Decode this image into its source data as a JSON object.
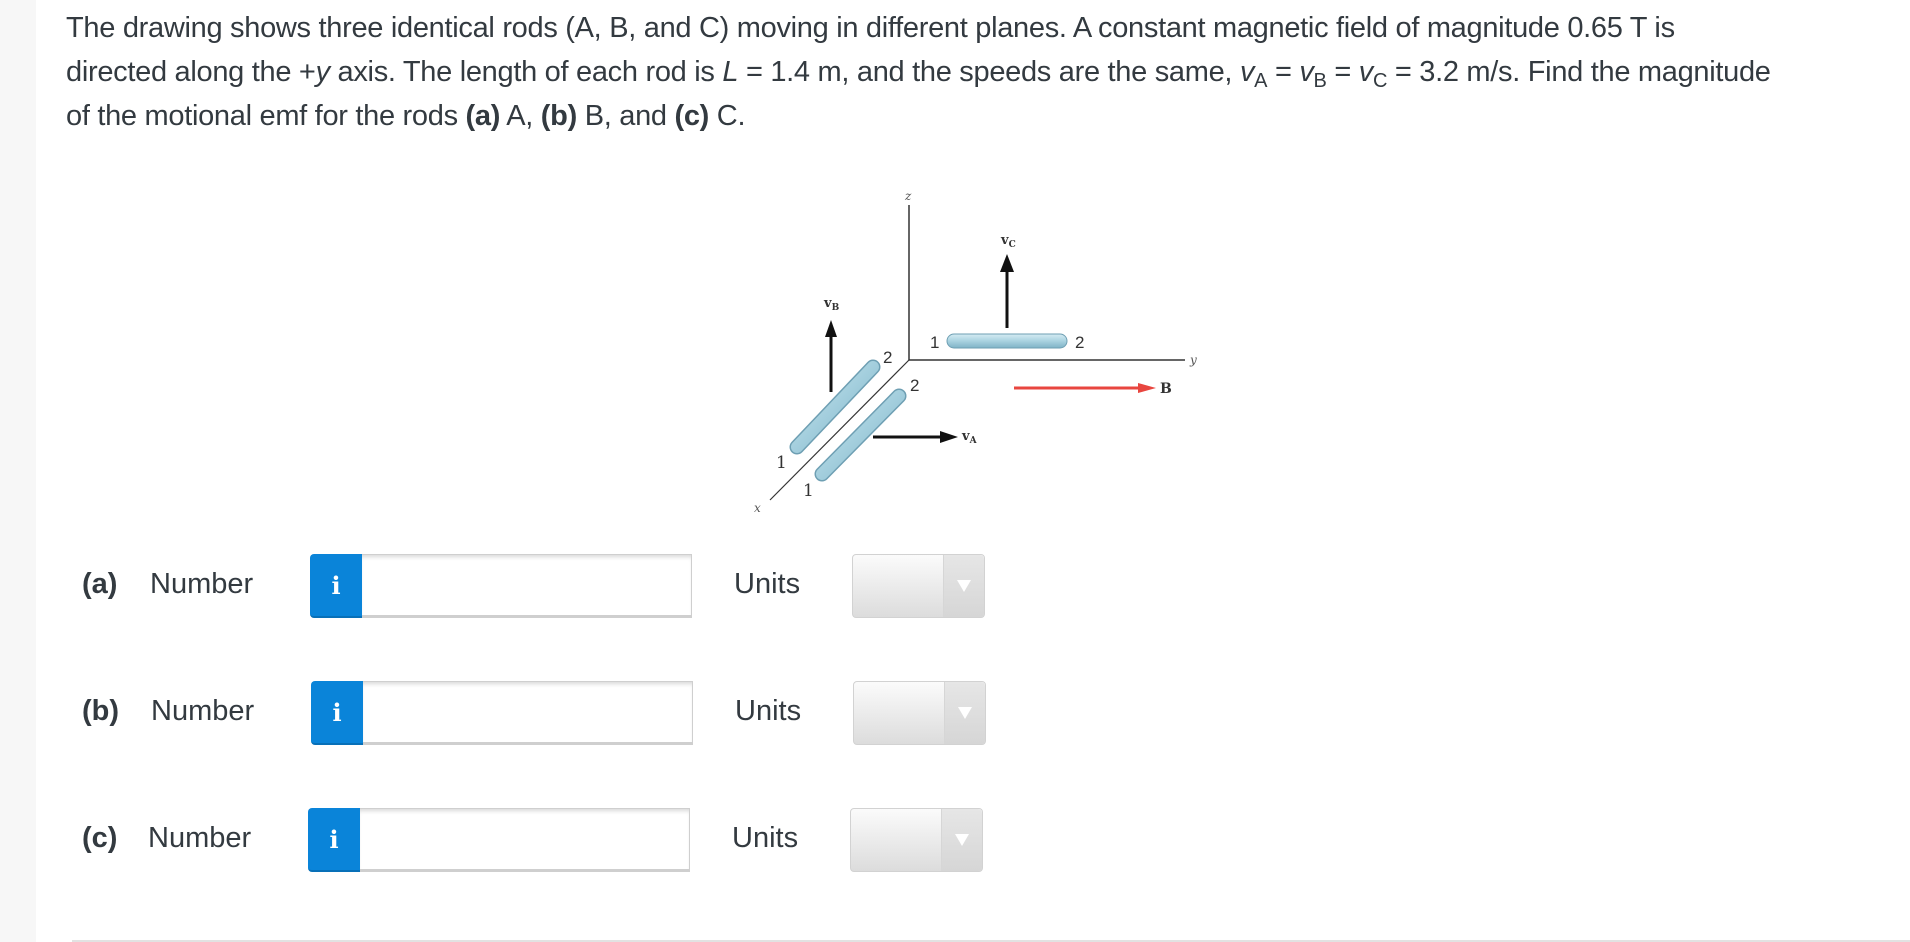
{
  "question": {
    "line1": "The drawing shows three identical rods (A, B, and C) moving in different planes. A constant magnetic field of magnitude 0.65 T is",
    "line2_a": "directed along the +",
    "line2_y": "y",
    "line2_b": " axis. The length of each rod is ",
    "line2_L": "L",
    "line2_c": " = 1.4 m, and the speeds are the same, ",
    "v": "v",
    "sub_A": "A",
    "sub_B": "B",
    "sub_C": "C",
    "eq": " = ",
    "line2_d": " = 3.2 m/s. Find the magnitude",
    "line3_a": "of the motional emf for the rods ",
    "pa": "(a)",
    "line3_b": " A, ",
    "pb": "(b)",
    "line3_c": " B, and ",
    "pc": "(c)",
    "line3_d": " C."
  },
  "figure": {
    "axis_labels": {
      "x": "x",
      "y": "y",
      "z": "z"
    },
    "vectors": {
      "vA": "v",
      "vA_sub": "A",
      "vB": "v",
      "vB_sub": "B",
      "vC": "v",
      "vC_sub": "C",
      "B": "B"
    },
    "end_labels": {
      "one": "1",
      "two": "2"
    },
    "colors": {
      "rod": "#a9d2e0",
      "rod_edge": "#6e9fb3",
      "field_arrow": "#e8463f",
      "axis": "#333333"
    }
  },
  "answers": [
    {
      "part": "(a)",
      "number_label": "Number",
      "info": "i",
      "value": "",
      "units_label": "Units",
      "units_selected": ""
    },
    {
      "part": "(b)",
      "number_label": "Number",
      "info": "i",
      "value": "",
      "units_label": "Units",
      "units_selected": ""
    },
    {
      "part": "(c)",
      "number_label": "Number",
      "info": "i",
      "value": "",
      "units_label": "Units",
      "units_selected": ""
    }
  ],
  "colors": {
    "info_button": "#0a84d9",
    "text": "#333a40"
  }
}
